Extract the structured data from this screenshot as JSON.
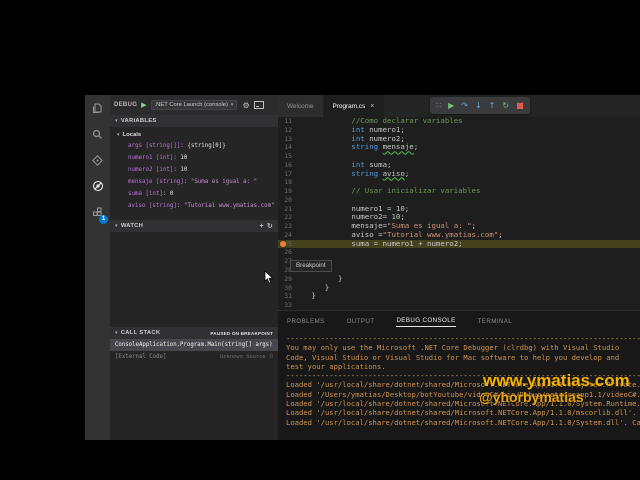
{
  "activity_bar": {
    "icons": [
      "explorer-icon",
      "search-icon",
      "source-control-icon",
      "debug-icon",
      "extensions-icon"
    ],
    "extensions_badge": "1"
  },
  "sidebar": {
    "debug_toolbar": {
      "title": "DEBUG",
      "play_icon": "▶",
      "config": ".NET Core Launch (console)",
      "dropdown_icon": "▾",
      "gear_icon": "⚙"
    },
    "variables": {
      "header": "VARIABLES",
      "twisty": "▾",
      "scope": "Locals",
      "items": [
        {
          "name": "args",
          "type": "[string[]]",
          "value": "{string[0]}",
          "kind": "object"
        },
        {
          "name": "numero1",
          "type": "[int]",
          "value": "10",
          "kind": "number"
        },
        {
          "name": "numero2",
          "type": "[int]",
          "value": "10",
          "kind": "number"
        },
        {
          "name": "mensaje",
          "type": "[string]",
          "value": "\"Suma es igual a: \"",
          "kind": "string"
        },
        {
          "name": "suma",
          "type": "[int]",
          "value": "0",
          "kind": "number"
        },
        {
          "name": "aviso",
          "type": "[string]",
          "value": "\"Tutorial www.ymatias.com\"",
          "kind": "string"
        }
      ]
    },
    "watch": {
      "header": "WATCH",
      "twisty": "▾",
      "icons": [
        {
          "name": "add-watch-icon",
          "glyph": "+"
        },
        {
          "name": "refresh-watch-icon",
          "glyph": "↻"
        }
      ]
    },
    "call_stack": {
      "header": "CALL STACK",
      "twisty": "▾",
      "badge": "PAUSED ON BREAKPOINT",
      "frames": [
        {
          "label": "ConsoleApplication.Program.Main(string[] args)",
          "selected": true
        },
        {
          "label": "[External Code]",
          "source": "Unknown Source",
          "line": "0"
        }
      ]
    }
  },
  "editor": {
    "tabs": [
      {
        "label": "Welcome",
        "active": false,
        "close": null
      },
      {
        "label": "Program.cs",
        "active": true,
        "close": "×"
      }
    ],
    "debug_controls": [
      {
        "name": "drag-handle",
        "glyph": "∷",
        "color": "#8a8a8a"
      },
      {
        "name": "continue-button",
        "glyph": "▶",
        "color": "#75c279"
      },
      {
        "name": "step-over-button",
        "glyph": "↷",
        "color": "#6fa8dc"
      },
      {
        "name": "step-into-button",
        "glyph": "↓",
        "color": "#6fa8dc"
      },
      {
        "name": "step-out-button",
        "glyph": "↑",
        "color": "#6fa8dc"
      },
      {
        "name": "restart-button",
        "glyph": "↻",
        "color": "#75c279"
      },
      {
        "name": "stop-button",
        "glyph": "■",
        "color": "#e05b4e"
      }
    ],
    "code": {
      "breakpoint_line": 25,
      "current_line": 25,
      "tooltip": "Breakpoint",
      "lines": [
        {
          "n": 11,
          "t": [
            [
              "c",
              "            //Como declarar variables"
            ]
          ]
        },
        {
          "n": 12,
          "t": [
            [
              "t",
              "            "
            ],
            [
              "k",
              "int"
            ],
            [
              "t",
              " numero1;"
            ]
          ]
        },
        {
          "n": 13,
          "t": [
            [
              "t",
              "            "
            ],
            [
              "k",
              "int"
            ],
            [
              "t",
              " numero2;"
            ]
          ]
        },
        {
          "n": 14,
          "t": [
            [
              "t",
              "            "
            ],
            [
              "k",
              "string"
            ],
            [
              "t",
              " "
            ],
            [
              "w",
              "mensaje"
            ],
            [
              "t",
              ";"
            ]
          ]
        },
        {
          "n": 15,
          "t": []
        },
        {
          "n": 16,
          "t": [
            [
              "t",
              "            "
            ],
            [
              "k",
              "int"
            ],
            [
              "t",
              " suma;"
            ]
          ]
        },
        {
          "n": 17,
          "t": [
            [
              "t",
              "            "
            ],
            [
              "k",
              "string"
            ],
            [
              "t",
              " "
            ],
            [
              "w",
              "aviso"
            ],
            [
              "t",
              ";"
            ]
          ]
        },
        {
          "n": 18,
          "t": []
        },
        {
          "n": 19,
          "t": [
            [
              "c",
              "            // Usar inicializar variables"
            ]
          ]
        },
        {
          "n": 20,
          "t": []
        },
        {
          "n": 21,
          "t": [
            [
              "t",
              "            numero1 = "
            ],
            [
              "n",
              "10"
            ],
            [
              "t",
              ";"
            ]
          ]
        },
        {
          "n": 22,
          "t": [
            [
              "t",
              "            numero2= "
            ],
            [
              "n",
              "10"
            ],
            [
              "t",
              ";"
            ]
          ]
        },
        {
          "n": 23,
          "t": [
            [
              "t",
              "            mensaje="
            ],
            [
              "s",
              "\"Suma es igual a: \""
            ],
            [
              "t",
              ";"
            ]
          ]
        },
        {
          "n": 24,
          "t": [
            [
              "t",
              "            aviso ="
            ],
            [
              "s",
              "\"Tutorial www.ymatias.com\""
            ],
            [
              "t",
              ";"
            ]
          ]
        },
        {
          "n": 25,
          "t": [
            [
              "t",
              "            suma = numero1 + numero2;"
            ]
          ]
        },
        {
          "n": 26,
          "t": []
        },
        {
          "n": 27,
          "t": []
        },
        {
          "n": 28,
          "t": []
        },
        {
          "n": 29,
          "t": [
            [
              "t",
              "         }"
            ]
          ]
        },
        {
          "n": 30,
          "t": [
            [
              "t",
              "      }"
            ]
          ]
        },
        {
          "n": 31,
          "t": [
            [
              "t",
              "   }"
            ]
          ]
        },
        {
          "n": 32,
          "t": []
        }
      ]
    }
  },
  "panel": {
    "tabs": [
      {
        "label": "PROBLEMS",
        "active": false
      },
      {
        "label": "OUTPUT",
        "active": false
      },
      {
        "label": "DEBUG CONSOLE",
        "active": true
      },
      {
        "label": "TERMINAL",
        "active": false
      }
    ],
    "console_lines": [
      {
        "cls": "dash",
        "text": "----------------------------------------------------------------------------------"
      },
      {
        "cls": "msg",
        "text": "You may only use the Microsoft .NET Core Debugger (clrdbg) with Visual Studio"
      },
      {
        "cls": "msg",
        "text": "Code, Visual Studio or Visual Studio for Mac software to help you develop and"
      },
      {
        "cls": "msg",
        "text": "test your applications."
      },
      {
        "cls": "dash",
        "text": "----------------------------------------------------------------------------------"
      },
      {
        "cls": "msg",
        "text": "Loaded '/usr/local/share/dotnet/shared/Microsoft.NETCore.App/1.1.0/System.Private.CoreLib.ni.dll'. Symbols loaded."
      },
      {
        "cls": "msg",
        "text": "Loaded '/Users/ymatias/Desktop/botYoutube/videoC#/bin/Debug/netcoreapp1.1/videoC#.dll'. Symbols loaded."
      },
      {
        "cls": "msg",
        "text": "Loaded '/usr/local/share/dotnet/shared/Microsoft.NETCore.App/1.1.0/System.Runtime.dll'. Cannot find or open the symbol file."
      },
      {
        "cls": "msg",
        "text": "Loaded '/usr/local/share/dotnet/shared/Microsoft.NETCore.App/1.1.0/mscorlib.dll'. Cannot find or open the symbol file."
      },
      {
        "cls": "msg",
        "text": "Loaded '/usr/local/share/dotnet/shared/Microsoft.NETCore.App/1.1.0/System.dll'. Cannot find or open the symbol file."
      }
    ]
  },
  "watermarks": {
    "site": "www.ymatias.com",
    "handle": "@yhorbymatias"
  },
  "colors": {
    "activity_bar_bg": "#333333",
    "sidebar_bg": "#252526",
    "editor_bg": "#1e1e1e",
    "panel_bg": "#181818",
    "current_line_bg": "#44411d",
    "breakpoint": "#e8823a",
    "console_text": "#d0924f",
    "watermark": "#f5b301",
    "badge_blue": "#007acc",
    "keyword": "#569cd6",
    "string": "#ce9178",
    "comment": "#6a9955",
    "variable_name": "#bb72d8"
  }
}
